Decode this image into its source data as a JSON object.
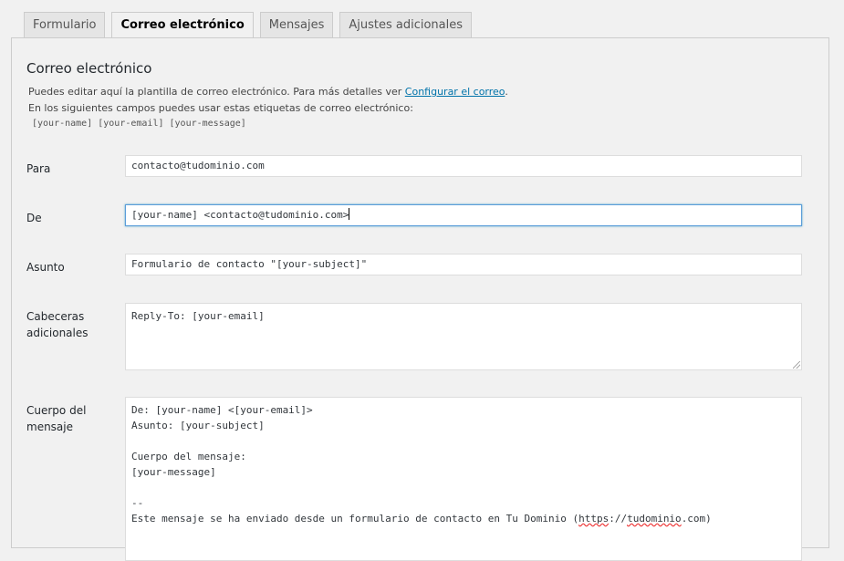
{
  "tabs": [
    {
      "label": "Formulario",
      "active": false
    },
    {
      "label": "Correo electrónico",
      "active": true
    },
    {
      "label": "Mensajes",
      "active": false
    },
    {
      "label": "Ajustes adicionales",
      "active": false
    }
  ],
  "section": {
    "title": "Correo electrónico",
    "desc_line1_prefix": "Puedes editar aquí la plantilla de correo electrónico. Para más detalles ver ",
    "desc_line1_link": "Configurar el correo",
    "desc_line1_suffix": ".",
    "desc_line2": "En los siguientes campos puedes usar estas etiquetas de correo electrónico:",
    "tags": "[your-name] [your-email] [your-message]"
  },
  "fields": {
    "to": {
      "label": "Para",
      "value": "contacto@tudominio.com"
    },
    "from": {
      "label": "De",
      "value": "[your-name] <contacto@tudominio.com>"
    },
    "subject": {
      "label": "Asunto",
      "value": "Formulario de contacto \"[your-subject]\""
    },
    "headers": {
      "label": "Cabeceras adicionales",
      "value": "Reply-To: [your-email]"
    },
    "body": {
      "label": "Cuerpo del mensaje",
      "lines": [
        "De: [your-name] <[your-email]>",
        "Asunto: [your-subject]",
        "",
        "Cuerpo del mensaje:",
        "[your-message]",
        "",
        "--"
      ],
      "last_line_prefix": "Este mensaje se ha enviado desde un formulario de contacto en Tu Dominio (",
      "last_line_link1": "https",
      "last_line_mid": "://",
      "last_line_link2": "tudominio",
      "last_line_suffix": ".com)"
    }
  }
}
